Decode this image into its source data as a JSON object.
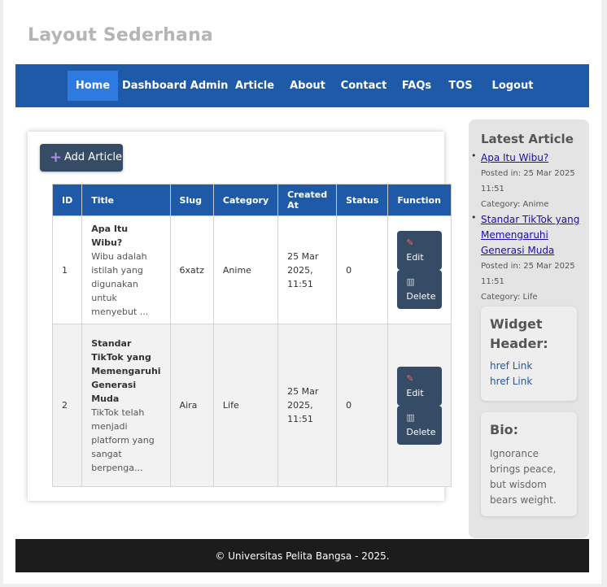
{
  "header": {
    "title": "Layout Sederhana"
  },
  "nav": {
    "items": [
      {
        "label": "Home",
        "active": true
      },
      {
        "label": "Dashboard Admin"
      },
      {
        "label": "Article"
      },
      {
        "label": "About"
      },
      {
        "label": "Contact"
      },
      {
        "label": "FAQs"
      },
      {
        "label": "TOS"
      },
      {
        "label": "Logout"
      }
    ]
  },
  "main": {
    "add_button": {
      "icon": "plus-icon",
      "label": "Add Article"
    },
    "table": {
      "headers": [
        "ID",
        "Title",
        "Slug",
        "Category",
        "Created At",
        "Status",
        "Function"
      ],
      "rows": [
        {
          "id": "1",
          "title": "Apa Itu Wibu?",
          "excerpt": "Wibu adalah istilah yang digunakan untuk menyebut ...",
          "slug": "6xatz",
          "category": "Anime",
          "created": "25 Mar 2025, 11:51",
          "status": "0"
        },
        {
          "id": "2",
          "title": "Standar TikTok yang Memengaruhi Generasi Muda",
          "excerpt": "TikTok telah menjadi platform yang sangat berpenga...",
          "slug": "Aira",
          "category": "Life",
          "created": "25 Mar 2025, 11:51",
          "status": "0"
        }
      ],
      "edit_label": "Edit",
      "delete_label": "Delete"
    }
  },
  "sidebar": {
    "latest_heading": "Latest Article",
    "latest": [
      {
        "title": "Apa Itu Wibu?",
        "posted": "Posted in: 25 Mar 2025 11:51",
        "category": "Category: Anime"
      },
      {
        "title": "Standar TikTok yang Memengaruhi Generasi Muda",
        "posted": "Posted in: 25 Mar 2025 11:51",
        "category": "Category: Life"
      }
    ],
    "widget": {
      "heading": "Widget Header:",
      "links": [
        "href Link",
        "href Link"
      ]
    },
    "bio": {
      "heading": "Bio:",
      "text": "Ignorance brings peace, but wisdom bears weight."
    }
  },
  "footer": {
    "text": "© Universitas Pelita Bangsa - 2025."
  },
  "colors": {
    "nav": "#1e5aa8",
    "nav_active": "#2d7be0",
    "button": "#364b66",
    "footer": "#1c1c1c"
  }
}
